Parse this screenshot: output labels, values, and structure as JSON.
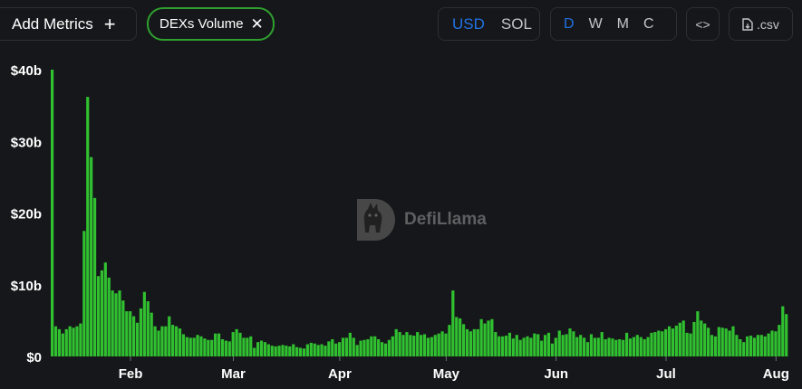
{
  "toolbar": {
    "add_metrics_label": "Add Metrics",
    "plus_glyph": "+",
    "metric_pill_label": "DEXs Volume",
    "close_glyph": "✕",
    "currency_options": [
      "USD",
      "SOL"
    ],
    "currency_selected": "USD",
    "granularity_options": [
      "D",
      "W",
      "M",
      "C"
    ],
    "granularity_selected": "D",
    "embed_label": "<>",
    "csv_label": ".csv"
  },
  "watermark": {
    "text": "DefiLlama",
    "icon": "llama-logo-icon"
  },
  "colors": {
    "bar": "#30c030",
    "background": "#16171a",
    "accent": "#2172e5",
    "pill_border": "#2fa02f"
  },
  "chart_data": {
    "type": "bar",
    "title": "",
    "xlabel": "",
    "ylabel": "",
    "ylim": [
      0,
      40
    ],
    "y_unit": "b",
    "y_ticks": [
      "$0",
      "$10b",
      "$20b",
      "$30b",
      "$40b"
    ],
    "x_ticks": [
      "Feb",
      "Mar",
      "Apr",
      "May",
      "Jun",
      "Jul",
      "Aug"
    ],
    "x_tick_day_index": [
      22,
      51,
      81,
      111,
      142,
      173,
      204
    ],
    "grid": false,
    "series": [
      {
        "values": [
          40,
          4.2,
          3.8,
          3.2,
          3.8,
          4.2,
          4.0,
          4.2,
          4.6,
          17.5,
          36.2,
          27.8,
          22.1,
          11.2,
          12.0,
          13.1,
          11.0,
          9.2,
          8.8,
          9.2,
          7.8,
          6.3,
          6.3,
          5.6,
          4.7,
          6.7,
          9.0,
          7.7,
          6.1,
          4.2,
          3.6,
          4.2,
          4.2,
          5.6,
          4.4,
          4.2,
          3.9,
          3.1,
          2.7,
          2.6,
          2.6,
          3.0,
          2.8,
          2.5,
          2.3,
          2.3,
          3.2,
          3.2,
          2.4,
          2.2,
          2.1,
          3.4,
          3.8,
          3.3,
          2.6,
          2.6,
          2.8,
          1.2,
          2.0,
          2.2,
          2.0,
          1.7,
          1.5,
          1.4,
          1.5,
          1.6,
          1.5,
          1.4,
          1.7,
          1.3,
          1.2,
          1.1,
          1.7,
          1.9,
          1.8,
          1.6,
          1.7,
          1.5,
          2.1,
          2.4,
          1.8,
          2.0,
          2.6,
          2.6,
          3.3,
          2.6,
          1.6,
          2.2,
          2.3,
          2.4,
          2.8,
          2.8,
          2.4,
          2.0,
          1.8,
          2.3,
          2.8,
          3.8,
          3.4,
          3.0,
          3.4,
          3.0,
          2.9,
          3.4,
          3.0,
          3.1,
          2.6,
          2.7,
          3.0,
          3.2,
          3.5,
          3.2,
          4.4,
          9.2,
          5.5,
          5.3,
          4.5,
          3.8,
          3.5,
          3.8,
          3.8,
          5.2,
          4.6,
          5.0,
          5.2,
          3.4,
          2.8,
          2.8,
          2.9,
          3.3,
          2.5,
          3.0,
          2.3,
          2.6,
          2.8,
          2.6,
          3.2,
          3.1,
          2.2,
          3.0,
          3.3,
          1.8,
          2.6,
          3.6,
          3.0,
          3.1,
          3.9,
          3.5,
          2.7,
          3.0,
          2.6,
          2.0,
          3.1,
          2.6,
          2.6,
          3.4,
          2.4,
          2.6,
          2.5,
          2.3,
          2.4,
          2.3,
          3.3,
          2.5,
          2.7,
          3.0,
          2.7,
          2.4,
          2.7,
          3.3,
          3.4,
          3.6,
          3.5,
          3.8,
          4.2,
          3.9,
          4.3,
          4.7,
          5.0,
          3.3,
          3.2,
          4.8,
          6.3,
          5.0,
          4.6,
          4.0,
          3.0,
          2.8,
          4.1,
          4.0,
          3.9,
          3.6,
          4.2,
          3.0,
          2.4,
          2.0,
          2.8,
          2.9,
          2.6,
          3.0,
          3.0,
          2.8,
          3.2,
          3.6,
          3.5,
          4.4,
          7.0,
          5.9
        ]
      }
    ]
  }
}
